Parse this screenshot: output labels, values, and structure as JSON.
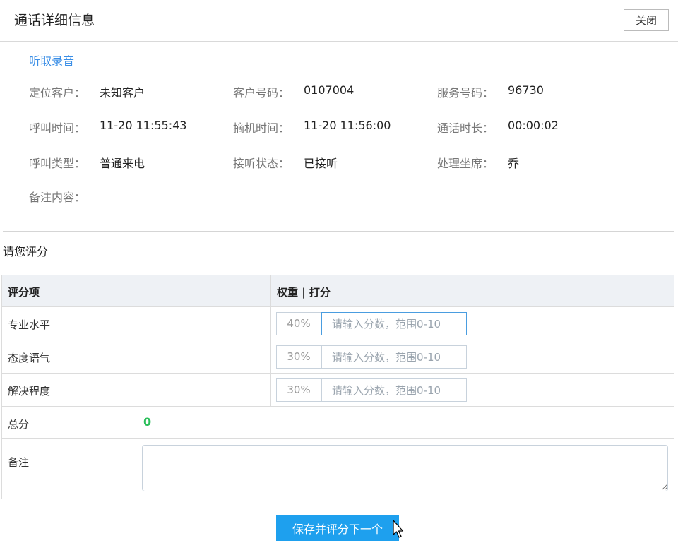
{
  "header": {
    "title": "通话详细信息",
    "close_label": "关闭"
  },
  "listen_recording_label": "听取录音",
  "info": {
    "locate_customer": {
      "label": "定位客户：",
      "value": "未知客户"
    },
    "customer_number": {
      "label": "客户号码：",
      "value": "0107004"
    },
    "service_number": {
      "label": "服务号码：",
      "value": "96730"
    },
    "call_time": {
      "label": "呼叫时间：",
      "value": "11-20 11:55:43"
    },
    "pickup_time": {
      "label": "摘机时间：",
      "value": "11-20 11:56:00"
    },
    "call_duration": {
      "label": "通话时长：",
      "value": "00:00:02"
    },
    "call_type": {
      "label": "呼叫类型：",
      "value": "普通来电"
    },
    "answer_status": {
      "label": "接听状态：",
      "value": "已接听"
    },
    "agent": {
      "label": "处理坐席：",
      "value": "乔"
    },
    "remarks": {
      "label": "备注内容：",
      "value": ""
    }
  },
  "rating": {
    "section_title": "请您评分",
    "col_item": "评分项",
    "col_weight": "权重 | 打分",
    "placeholder": "请输入分数，范围0-10",
    "items": [
      {
        "label": "专业水平",
        "weight": "40%",
        "value": ""
      },
      {
        "label": "态度语气",
        "weight": "30%",
        "value": ""
      },
      {
        "label": "解决程度",
        "weight": "30%",
        "value": ""
      }
    ],
    "total_label": "总分",
    "total_value": "0",
    "note_label": "备注",
    "note_value": ""
  },
  "submit_label": "保存并评分下一个",
  "colors": {
    "link": "#3a8ee6",
    "primary": "#1ea0ee",
    "total": "#2cbf5b",
    "header_bg": "#eef1f5"
  }
}
